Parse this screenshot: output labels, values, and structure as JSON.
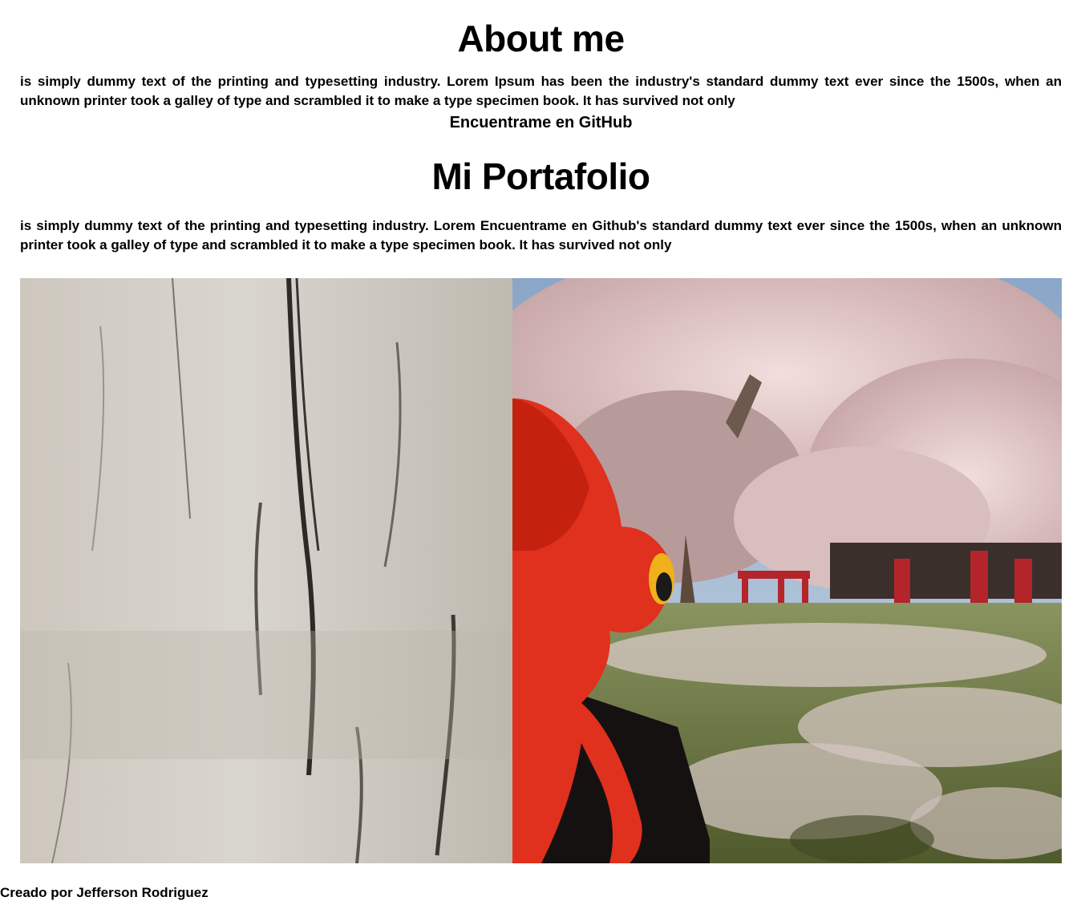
{
  "about": {
    "title": "About me",
    "paragraph": "is simply dummy text of the printing and typesetting industry. Lorem Ipsum has been the industry's standard dummy text ever since the 1500s, when an unknown printer took a galley of type and scrambled it to make a type specimen book. It has survived not only",
    "github_link": "Encuentrame en GitHub"
  },
  "portfolio": {
    "title": "Mi Portafolio",
    "paragraph": "is simply dummy text of the printing and typesetting industry. Lorem Encuentrame en Github's standard dummy text ever since the 1500s, when an unknown printer took a galley of type and scrambled it to make a type specimen book. It has survived not only"
  },
  "colors": {
    "background": "#ffffff",
    "text": "#000000",
    "character_red": "#e0301e",
    "blossom_pink": "#e8cfd0",
    "grass_green": "#6b7a3a",
    "wood_gray": "#cfcac2"
  },
  "footer": {
    "credit": "Creado por Jefferson Rodriguez"
  }
}
